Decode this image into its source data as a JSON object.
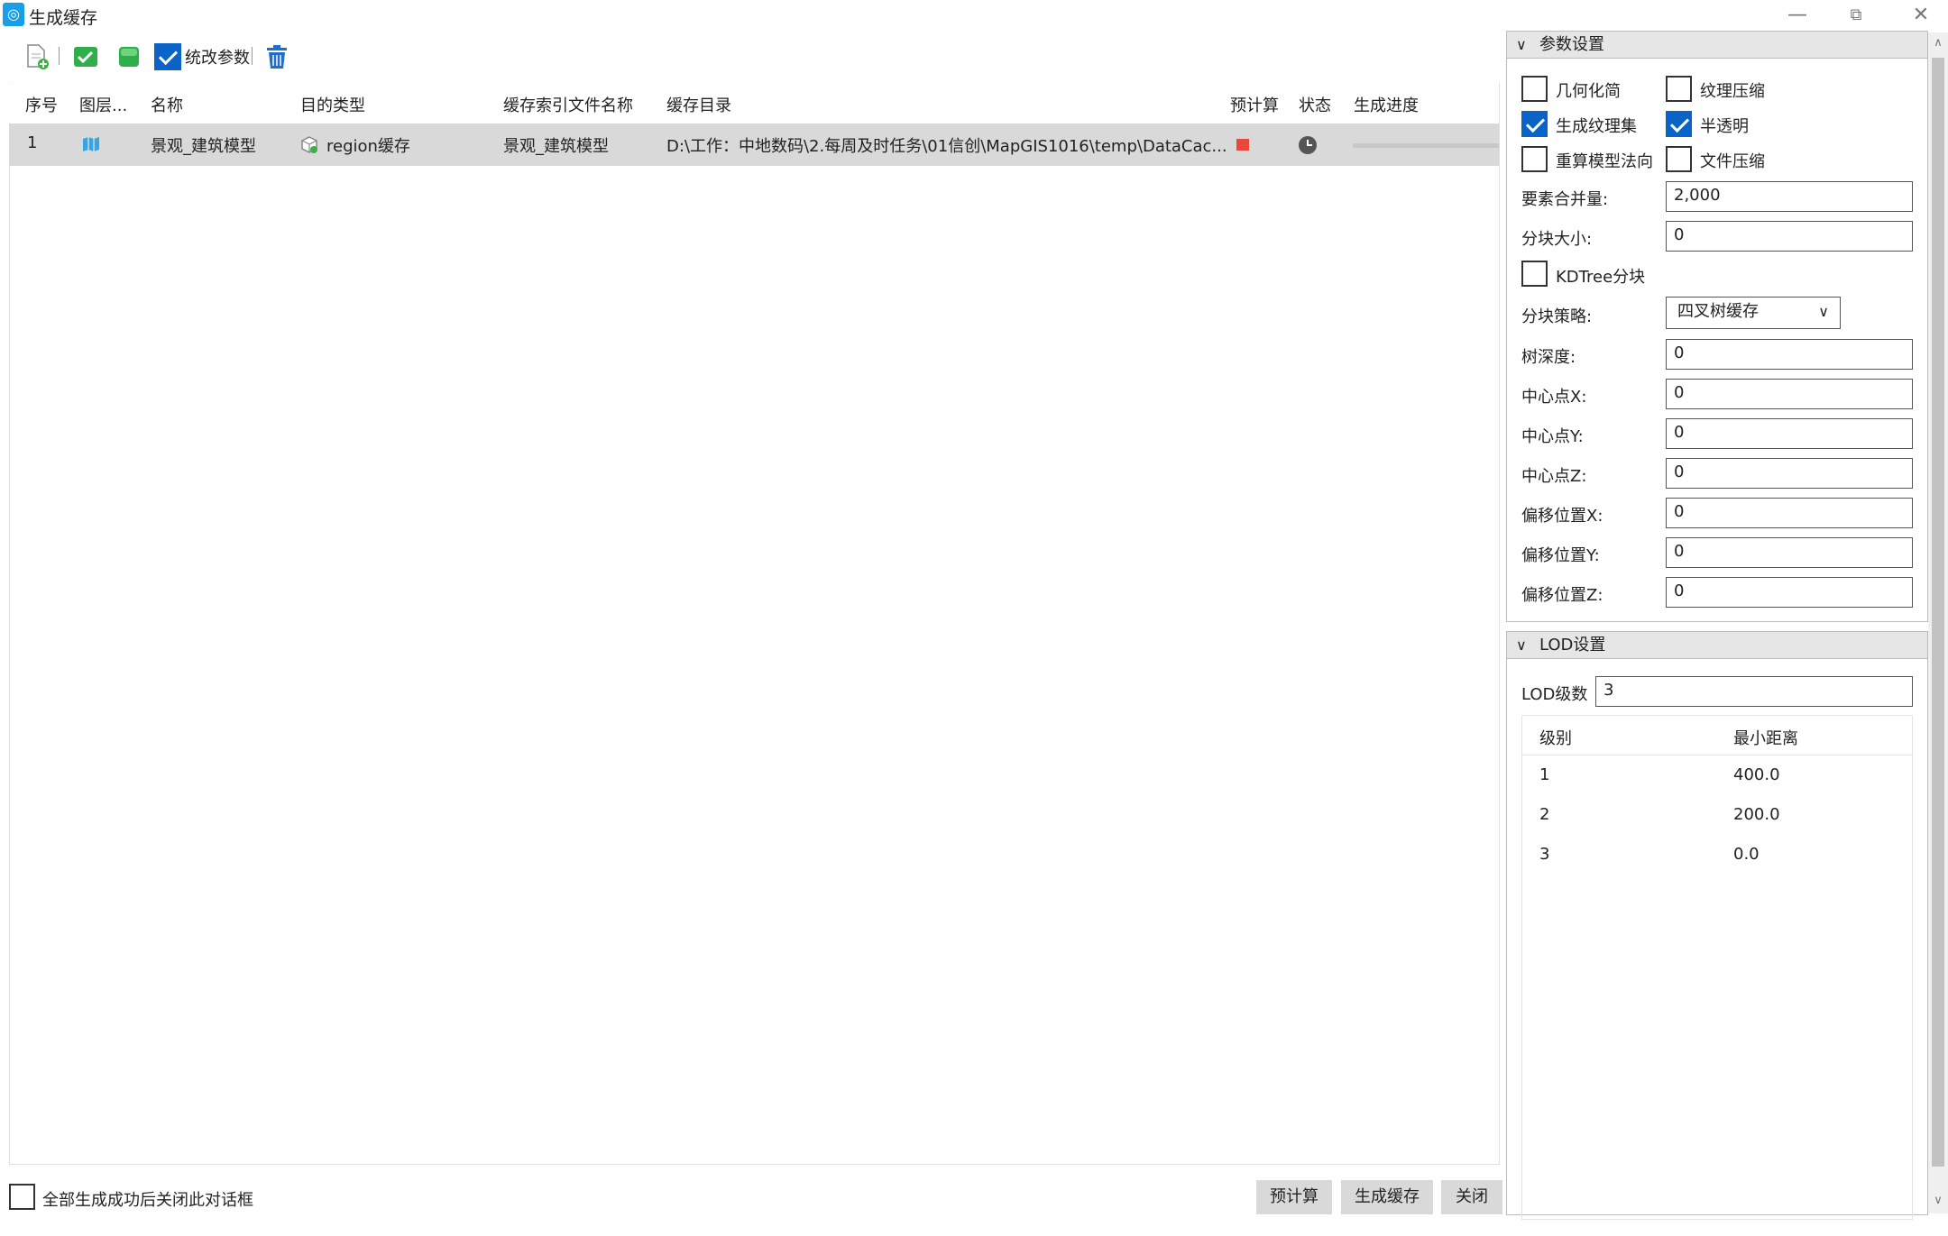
{
  "window": {
    "title": "生成缓存",
    "app_icon": "mapgis-logo-icon",
    "minimize": "—",
    "restore": "⧉",
    "close": "✕"
  },
  "toolbar": {
    "icons": [
      "add-file-icon",
      "select-all-icon",
      "layer-green-icon",
      "checkbox-icon",
      "delete-icon"
    ],
    "edit_params_label": "统改参数"
  },
  "grid": {
    "headers": [
      "序号",
      "图层...",
      "名称",
      "目的类型",
      "缓存索引文件名称",
      "缓存目录",
      "预计算",
      "状态",
      "生成进度"
    ],
    "rows": [
      {
        "index": "1",
        "layer_icon": "layer-icon",
        "name": "景观_建筑模型",
        "target_type": "region缓存",
        "index_file": "景观_建筑模型",
        "cache_dir": "D:\\工作：中地数码\\2.每周及时任务\\01信创\\MapGIS1016\\temp\\DataCac...",
        "precompute_color": "#e8493a",
        "status_icon": "clock-icon",
        "progress": 0
      }
    ]
  },
  "bottom": {
    "close_after_label": "全部生成成功后关闭此对话框",
    "close_after_checked": false,
    "precompute_btn": "预计算",
    "generate_btn": "生成缓存",
    "close_btn": "关闭"
  },
  "params": {
    "title": "参数设置",
    "checks": [
      {
        "label": "几何化简",
        "checked": false
      },
      {
        "label": "纹理压缩",
        "checked": false
      },
      {
        "label": "生成纹理集",
        "checked": true
      },
      {
        "label": "半透明",
        "checked": true
      },
      {
        "label": "重算模型法向",
        "checked": false
      },
      {
        "label": "文件压缩",
        "checked": false
      }
    ],
    "merge_label": "要素合并量:",
    "merge_value": "2,000",
    "tile_size_label": "分块大小:",
    "tile_size_value": "0",
    "kdtree_label": "KDTree分块",
    "kdtree_checked": false,
    "strategy_label": "分块策略:",
    "strategy_value": "四叉树缓存",
    "fields": [
      {
        "label": "树深度:",
        "value": "0"
      },
      {
        "label": "中心点X:",
        "value": "0"
      },
      {
        "label": "中心点Y:",
        "value": "0"
      },
      {
        "label": "中心点Z:",
        "value": "0"
      },
      {
        "label": "偏移位置X:",
        "value": "0"
      },
      {
        "label": "偏移位置Y:",
        "value": "0"
      },
      {
        "label": "偏移位置Z:",
        "value": "0"
      }
    ]
  },
  "lod": {
    "title": "LOD设置",
    "levels_label": "LOD级数",
    "levels_value": "3",
    "col_level": "级别",
    "col_min_dist": "最小距离",
    "rows": [
      {
        "level": "1",
        "dist": "400.0"
      },
      {
        "level": "2",
        "dist": "200.0"
      },
      {
        "level": "3",
        "dist": "0.0"
      }
    ]
  }
}
